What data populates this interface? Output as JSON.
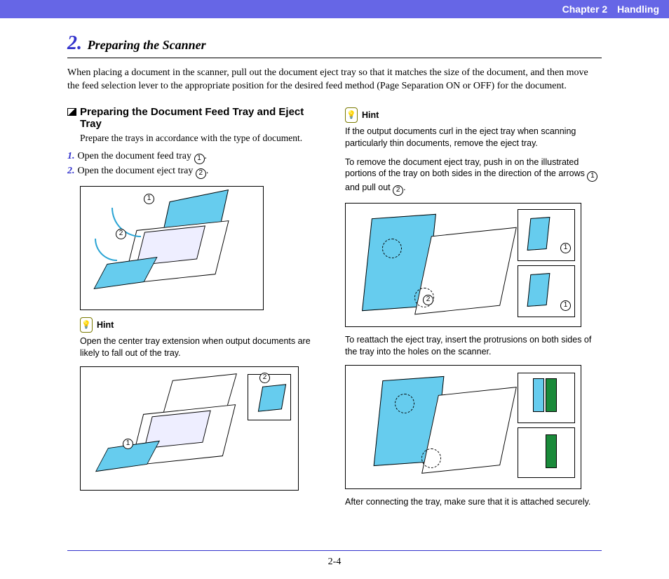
{
  "header": {
    "chapter": "Chapter 2",
    "title": "Handling"
  },
  "section": {
    "number": "2.",
    "title": "Preparing the Scanner"
  },
  "intro": "When placing a document in the scanner, pull out the document eject tray so that it matches the size of the document, and then move the feed selection lever to the appropriate position for the desired feed method (Page Separation ON or OFF) for the document.",
  "left": {
    "subheading": "Preparing the Document Feed Tray and Eject Tray",
    "subdesc": "Prepare the trays in accordance with the type of document.",
    "step1_num": "1.",
    "step1_pre": "Open the document feed tray ",
    "step1_mark": "1",
    "step1_post": ".",
    "step2_num": "2.",
    "step2_pre": "Open the document eject tray ",
    "step2_mark": "2",
    "step2_post": ".",
    "fig1_mark1": "1",
    "fig1_mark2": "2",
    "hint_label": "Hint",
    "hint1_text": "Open the center tray extension when output documents are likely to fall out of the tray.",
    "fig2_mark1": "1",
    "fig2_mark2": "2"
  },
  "right": {
    "hint_label": "Hint",
    "hint2_text": "If the output documents curl in the eject tray when scanning particularly thin documents, remove the eject tray.",
    "para1_pre": "To remove the document eject tray, push in on the illustrated portions of the tray on both sides in the direction of the arrows ",
    "para1_m1": "1",
    "para1_mid": " and pull out ",
    "para1_m2": "2",
    "para1_post": ".",
    "fig3_mark1a": "1",
    "fig3_mark1b": "1",
    "fig3_mark2": "2",
    "para2": "To reattach the eject tray, insert the protrusions on both sides of the tray into the holes on the scanner.",
    "para3": "After connecting the tray, make sure that it is attached securely."
  },
  "footer": {
    "page": "2-4"
  }
}
